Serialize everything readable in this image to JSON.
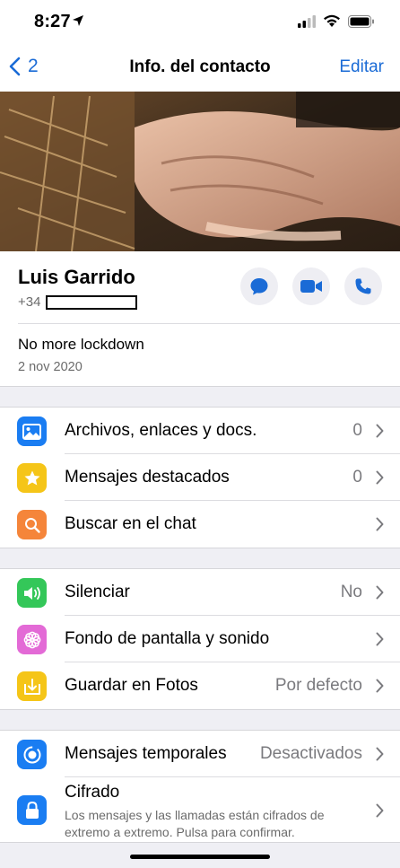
{
  "status_bar": {
    "time": "8:27"
  },
  "nav": {
    "back_count": "2",
    "title": "Info. del contacto",
    "edit_label": "Editar"
  },
  "contact": {
    "name": "Luis Garrido",
    "phone_prefix": "+34",
    "status": "No more lockdown",
    "status_date": "2 nov 2020"
  },
  "groups": [
    [
      {
        "icon": "photo-icon",
        "color": "#1a7df2",
        "label": "Archivos, enlaces y docs.",
        "value": "0"
      },
      {
        "icon": "star-icon",
        "color": "#f5c518",
        "label": "Mensajes destacados",
        "value": "0"
      },
      {
        "icon": "search-icon",
        "color": "#f5853a",
        "label": "Buscar en el chat",
        "value": ""
      }
    ],
    [
      {
        "icon": "speaker-icon",
        "color": "#34c759",
        "label": "Silenciar",
        "value": "No"
      },
      {
        "icon": "flower-icon",
        "color": "#e36ad6",
        "label": "Fondo de pantalla y sonido",
        "value": ""
      },
      {
        "icon": "save-icon",
        "color": "#f5c518",
        "label": "Guardar en Fotos",
        "value": "Por defecto"
      }
    ],
    [
      {
        "icon": "timer-icon",
        "color": "#1a7df2",
        "label": "Mensajes temporales",
        "value": "Desactivados"
      },
      {
        "icon": "lock-icon",
        "color": "#1a7df2",
        "label": "Cifrado",
        "value": "",
        "sub": "Los mensajes y las llamadas están cifrados de extremo a extremo. Pulsa para confirmar."
      }
    ]
  ],
  "colors": {
    "accent": "#1a6bd6"
  }
}
